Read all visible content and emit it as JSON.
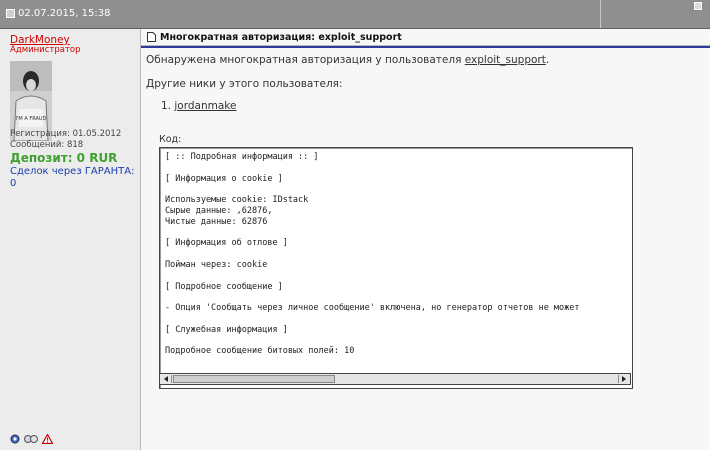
{
  "header": {
    "date": "02.07.2015, 15:38"
  },
  "user": {
    "name": "DarkMoney",
    "role": "Администратор",
    "avatar_text": "I'M A FRAUD",
    "registered": "Регистрация: 01.05.2012",
    "messages": "Сообщений: 818",
    "deposit": "Депозит: 0 RUR",
    "deals": "Сделок через ГАРАНТА: 0"
  },
  "post": {
    "title": "Многократная авторизация: exploit_support",
    "message_prefix": "Обнаружена многократная авторизация у пользователя",
    "message_user": "exploit_support",
    "message_suffix": ".",
    "others_label": "Другие ники у этого пользователя:",
    "nick_num": "1.",
    "nick": "jordanmake",
    "code_label": "Код:",
    "code_lines": [
      "[ :: Подробная информация :: ]",
      "",
      "[ Информация о cookie ]",
      "",
      "Используемые cookie: IDstack",
      "Сырые данные: ,62876,",
      "Чистые данные: 62876",
      "",
      "[ Информация об отлове ]",
      "",
      "Пойман через: cookie",
      "",
      "[ Подробное сообщение ]",
      "",
      "- Опция 'Сообщать через личное сообщение' включена, но генератор отчетов не может",
      "",
      "[ Служебная информация ]",
      "",
      "Подробное сообщение битовых полей: 10"
    ]
  },
  "colors": {
    "header_bg": "#8f8f8f",
    "username": "#d00000",
    "deposit": "#3fa12f",
    "deals": "#1a3fb0",
    "post_rule": "#2c3a9a"
  }
}
